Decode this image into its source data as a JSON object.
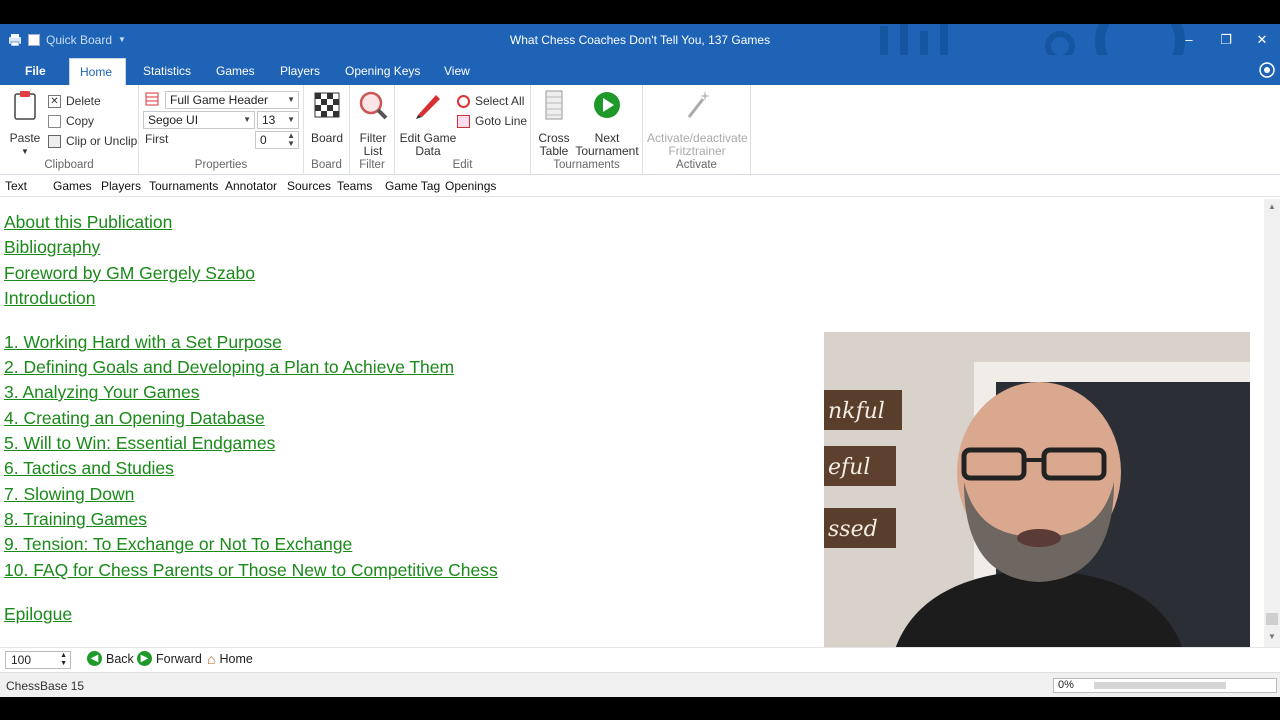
{
  "window": {
    "quick_board": "Quick Board",
    "title": "What Chess Coaches Don't Tell You,  137 Games",
    "minimize": "–",
    "maximize": "❐",
    "close": "✕"
  },
  "ribbon_tabs": [
    "File",
    "Home",
    "Statistics",
    "Games",
    "Players",
    "Opening Keys",
    "View"
  ],
  "clipboard": {
    "paste": "Paste",
    "delete": "Delete",
    "copy": "Copy",
    "clip": "Clip or Unclip",
    "label": "Clipboard"
  },
  "properties": {
    "header_value": "Full Game Header",
    "font_value": "Segoe UI",
    "size_value": "13",
    "first_label": "First",
    "first_value": "0",
    "label": "Properties"
  },
  "board_group": {
    "board": "Board",
    "label": "Board"
  },
  "filter_group": {
    "filter_list_line1": "Filter",
    "filter_list_line2": "List",
    "label": "Filter"
  },
  "edit_group": {
    "edit_line1": "Edit Game",
    "edit_line2": "Data",
    "select_all": "Select All",
    "goto_line": "Goto Line",
    "label": "Edit"
  },
  "tournaments_group": {
    "cross_line1": "Cross",
    "cross_line2": "Table",
    "next_line1": "Next",
    "next_line2": "Tournament",
    "label": "Tournaments"
  },
  "activate_group": {
    "line1": "Activate/deactivate",
    "line2": "Fritztrainer",
    "label": "Activate"
  },
  "subtabs": [
    "Text",
    "Games",
    "Players",
    "Tournaments",
    "Annotator",
    "Sources",
    "Teams",
    "Game Tag",
    "Openings"
  ],
  "contents": {
    "front": [
      "About this Publication",
      "Bibliography",
      "Foreword by GM Gergely Szabo",
      "Introduction"
    ],
    "chapters": [
      "1. Working Hard with a Set Purpose",
      "2. Defining Goals and Developing a Plan to Achieve Them",
      "3. Analyzing Your Games",
      "4. Creating an Opening Database",
      "5. Will to Win: Essential Endgames",
      "6. Tactics and Studies",
      "7. Slowing Down",
      "8. Training Games",
      "9. Tension: To Exchange or Not To Exchange",
      "10. FAQ for Chess Parents or Those New to Competitive Chess"
    ],
    "epilogue": "Epilogue"
  },
  "webcam": {
    "signs": [
      "nkful",
      "eful",
      "ssed"
    ]
  },
  "nav": {
    "zoom": "100",
    "back": "Back",
    "forward": "Forward",
    "home": "Home"
  },
  "status": {
    "app": "ChessBase 15",
    "progress": "0%"
  },
  "colors": {
    "accent": "#1e63b6",
    "link": "#1a8a1a"
  }
}
